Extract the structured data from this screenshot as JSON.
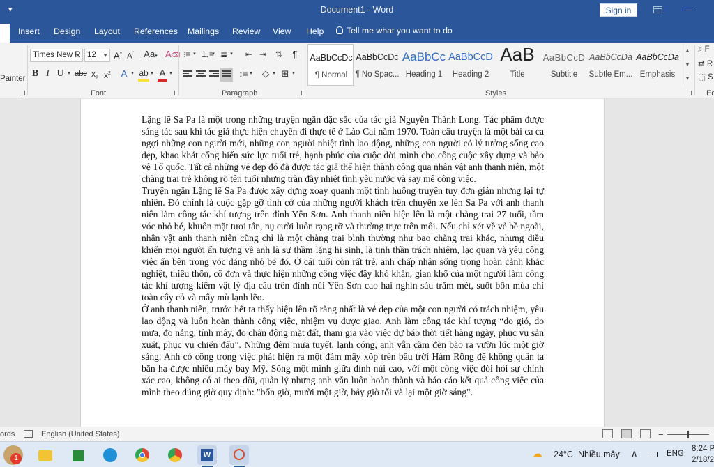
{
  "window": {
    "title": "Document1 - Word",
    "signin_label": "Sign in"
  },
  "tabs": [
    "Insert",
    "Design",
    "Layout",
    "References",
    "Mailings",
    "Review",
    "View",
    "Help"
  ],
  "tellme": "Tell me what you want to do",
  "clipboard": {
    "painter_label": "Painter"
  },
  "font": {
    "name": "Times New R",
    "size": "12",
    "group_label": "Font",
    "highlight_color": "#f7e13a",
    "font_color": "#d42a2a"
  },
  "paragraph": {
    "group_label": "Paragraph",
    "shading_color": "#f3f3f3"
  },
  "styles": {
    "group_label": "Styles",
    "items": [
      {
        "preview": "AaBbCcDc",
        "name": "¶ Normal"
      },
      {
        "preview": "AaBbCcDc",
        "name": "¶ No Spac..."
      },
      {
        "preview": "AaBbCc",
        "name": "Heading 1"
      },
      {
        "preview": "AaBbCcD",
        "name": "Heading 2"
      },
      {
        "preview": "AaB",
        "name": "Title"
      },
      {
        "preview": "AaBbCcD",
        "name": "Subtitle"
      },
      {
        "preview": "AaBbCcDa",
        "name": "Subtle Em..."
      },
      {
        "preview": "AaBbCcDa",
        "name": "Emphasis"
      }
    ]
  },
  "editing": {
    "items": [
      "F",
      "R",
      "S"
    ],
    "group_label": "Ed"
  },
  "document": {
    "paragraphs": [
      "Lặng lẽ Sa Pa là một trong những truyện ngắn đặc sắc của tác giả Nguyễn Thành Long. Tác phẩm được sáng tác sau khi tác giả thực hiện chuyến đi thực tế ở Lào Cai năm 1970. Toàn câu truyện là một bài ca ca ngợi những con người mới, những con người nhiệt tình lao động, những con người có lý tưởng sống cao đẹp, khao khát cống hiến sức lực tuổi trẻ, hạnh phúc của cuộc đời mình cho công cuộc xây dựng và bảo vệ Tổ quốc. Tất cả những vẻ đẹp đó đã được tác giả thể hiện thành công qua nhân vật anh thanh niên, một chàng trai trẻ không rõ tên tuổi nhưng tràn đầy nhiệt tình yêu nước và say mê công việc.",
      "Truyện ngắn Lặng lẽ Sa Pa được xây dựng xoay quanh một tình huống truyện tuy đơn giản nhưng lại tự nhiên. Đó chính là cuộc gặp gỡ tình cờ của những người khách trên chuyến xe lên Sa Pa với anh thanh niên làm công tác khí tượng trên đỉnh Yên Sơn. Anh thanh niên hiện lên là một chàng trai 27 tuổi, tầm vóc nhỏ bé, khuôn mặt tươi tắn, nụ cười luôn rạng rỡ và thường trực trên môi. Nếu chỉ xét về vẻ bề ngoài, nhân vật anh thanh niên cũng chỉ là một chàng trai bình thường như bao chàng trai khác, nhưng điều khiến mọi người ấn tượng về anh là sự thầm lặng hi sinh, là tinh thần trách nhiệm, lạc quan và yêu công việc ẩn bên trong vóc dáng nhỏ bé đó. Ở cái tuổi còn rất trẻ, anh chấp nhận sống trong hoàn cảnh khắc nghiệt, thiếu thốn, cô đơn và thực hiện những công việc đầy khó khăn, gian khổ của một người làm công tác khí tượng kiêm vật lý địa cầu trên đỉnh núi Yên Sơn cao hai nghìn sáu trăm mét, suốt bốn mùa chỉ toàn cây cỏ và mây mù lạnh lẽo.",
      "Ở anh thanh niên, trước hết ta thấy hiện lên rõ ràng nhất là vẻ đẹp của một con người có trách nhiệm, yêu lao động và luôn hoàn thành công việc, nhiệm vụ được giao. Anh làm công tác khí tượng “đo gió, đo mưa, đo nắng, tính mây, đo chấn động mặt đất, tham gia vào việc dự báo thời tiết hàng ngày, phục vụ sản xuất, phục vụ chiến đấu”. Những đêm mưa tuyết, lạnh cóng, anh vẫn cầm đèn bão ra vườn lúc một giờ sáng. Anh có công trong việc phát hiện ra một đám mây xốp trên bầu trời Hàm Rồng để không quân ta bắn hạ được nhiều máy bay Mỹ. Sống một mình giữa đỉnh núi cao, với một công việc đòi hỏi sự chính xác cao, không có ai theo dõi, quản lý nhưng anh vẫn luôn hoàn thành và báo cáo kết quả công việc của mình theo đúng giờ quy định: \"bốn giờ, mười một giờ, bảy giờ tối và lại một giờ sáng\"."
    ]
  },
  "status": {
    "words_label": "ords",
    "language": "English (United States)",
    "zoom_minus": "−"
  },
  "taskbar": {
    "badge": "1",
    "weather_temp": "24°C",
    "weather_text": "Nhiều mây",
    "lang": "ENG",
    "time": "8:24 P",
    "date": "2/18/20"
  },
  "colors": {
    "brand": "#2b579a"
  }
}
